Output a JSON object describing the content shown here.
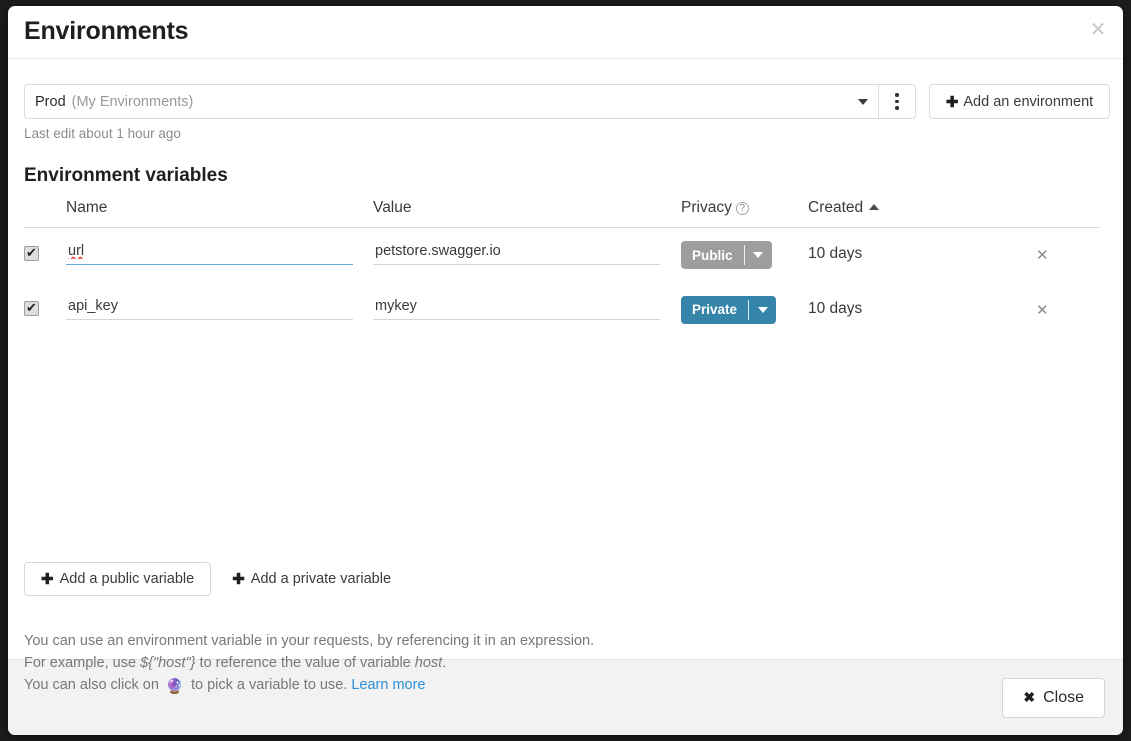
{
  "modal": {
    "title": "Environments",
    "close_icon": "close-icon",
    "footer": {
      "close_label": "Close",
      "close_icon": "x-icon"
    }
  },
  "env_selector": {
    "name": "Prod",
    "group": "(My Environments)",
    "caret_icon": "chevron-down-icon",
    "kebab_icon": "kebab-menu-icon",
    "add_environment_label": "Add an environment",
    "add_environment_icon": "plus-icon",
    "last_edit": "Last edit about 1 hour ago"
  },
  "variables_section": {
    "title": "Environment variables",
    "columns": {
      "name": "Name",
      "value": "Value",
      "privacy": "Privacy",
      "privacy_help_icon": "question-mark-icon",
      "created": "Created",
      "created_sort_icon": "sort-ascending-icon"
    },
    "rows": [
      {
        "checked": true,
        "name": "url",
        "value": "petstore.swagger.io",
        "privacy": "Public",
        "privacy_color": "#9d9d9d",
        "created": "10 days",
        "delete_icon": "close-icon",
        "name_focused": true,
        "name_spellcheck_error": true
      },
      {
        "checked": true,
        "name": "api_key",
        "value": "mykey",
        "privacy": "Private",
        "privacy_color": "#3585ab",
        "created": "10 days",
        "delete_icon": "close-icon",
        "name_focused": false,
        "name_spellcheck_error": false
      }
    ],
    "add_public_label": "Add a public variable",
    "add_private_label": "Add a private variable",
    "add_icon": "plus-icon"
  },
  "help": {
    "line1": "You can use an environment variable in your requests, by referencing it in an expression.",
    "line2_pre": "For example, use ",
    "line2_code": "${\"host\"}",
    "line2_mid": " to reference the value of variable ",
    "line2_var": "host",
    "line2_post": ".",
    "line3_pre": "You can also click on ",
    "line3_icon": "magic-wand-icon",
    "line3_mid": " to pick a variable to use. ",
    "line3_link": "Learn more"
  }
}
